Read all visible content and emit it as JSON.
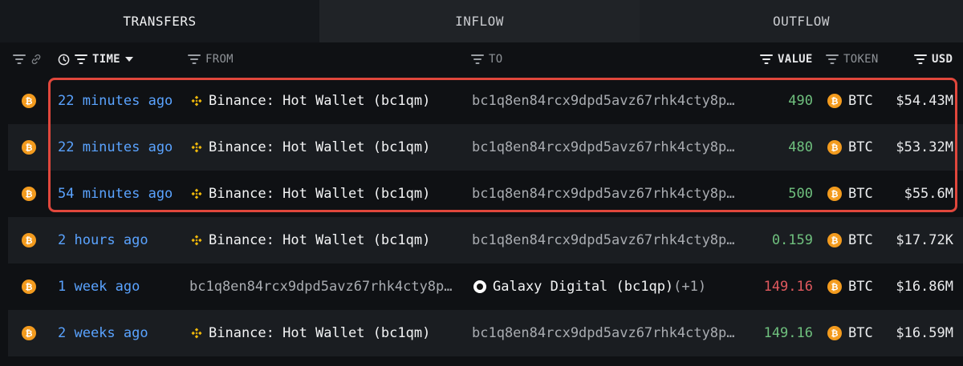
{
  "tabs": [
    {
      "label": "TRANSFERS",
      "active": true
    },
    {
      "label": "INFLOW",
      "active": false
    },
    {
      "label": "OUTFLOW",
      "active": false
    }
  ],
  "columns": {
    "time": "TIME",
    "from": "FROM",
    "to": "TO",
    "value": "VALUE",
    "token": "TOKEN",
    "usd": "USD"
  },
  "rows": [
    {
      "time": "22 minutes ago",
      "from": "Binance: Hot Wallet (bc1qm)",
      "to": "bc1q8en84rcx9dpd5avz67rhk4cty8p…",
      "value": "490",
      "value_color": "green",
      "token": "BTC",
      "usd": "$54.43M"
    },
    {
      "time": "22 minutes ago",
      "from": "Binance: Hot Wallet (bc1qm)",
      "to": "bc1q8en84rcx9dpd5avz67rhk4cty8p…",
      "value": "480",
      "value_color": "green",
      "token": "BTC",
      "usd": "$53.32M"
    },
    {
      "time": "54 minutes ago",
      "from": "Binance: Hot Wallet (bc1qm)",
      "to": "bc1q8en84rcx9dpd5avz67rhk4cty8p…",
      "value": "500",
      "value_color": "green",
      "token": "BTC",
      "usd": "$55.6M"
    },
    {
      "time": "2 hours ago",
      "from": "Binance: Hot Wallet (bc1qm)",
      "to": "bc1q8en84rcx9dpd5avz67rhk4cty8p…",
      "value": "0.159",
      "value_color": "green",
      "token": "BTC",
      "usd": "$17.72K"
    },
    {
      "time": "1 week ago",
      "from": "bc1q8en84rcx9dpd5avz67rhk4cty8p…",
      "to": "Galaxy Digital (bc1qp)",
      "to_extra": "(+1)",
      "value": "149.16",
      "value_color": "red",
      "token": "BTC",
      "usd": "$16.86M"
    },
    {
      "time": "2 weeks ago",
      "from": "Binance: Hot Wallet (bc1qm)",
      "to": "bc1q8en84rcx9dpd5avz67rhk4cty8p…",
      "value": "149.16",
      "value_color": "green",
      "token": "BTC",
      "usd": "$16.59M"
    }
  ],
  "colors": {
    "time_link": "#5aa3ff",
    "value_in": "#6fc07e",
    "value_out": "#e0595e",
    "btc": "#f39b1e",
    "binance": "#f0b90b",
    "highlight": "#e0473c"
  }
}
